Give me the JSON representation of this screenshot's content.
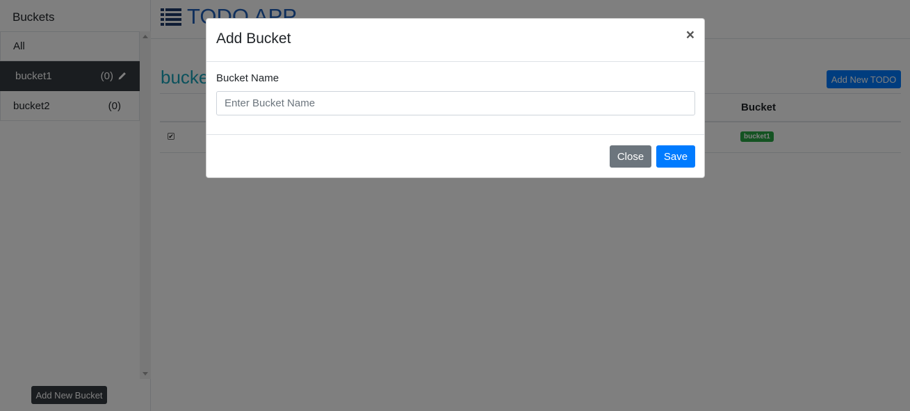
{
  "sidebar": {
    "title": "Buckets",
    "items": [
      {
        "name": "All",
        "count": ""
      },
      {
        "name": "bucket1",
        "count": "(0)"
      },
      {
        "name": "bucket2",
        "count": "(0)"
      }
    ],
    "add_button": "Add New Bucket"
  },
  "header": {
    "app_title": "TODO APP"
  },
  "main": {
    "section_title": "bucket1",
    "add_todo_button": "Add New TODO",
    "table": {
      "columns": [
        "",
        "Bucket"
      ],
      "rows": [
        {
          "checked": true,
          "bucket": "bucket1"
        }
      ]
    }
  },
  "modal": {
    "title": "Add Bucket",
    "close_symbol": "×",
    "field_label": "Bucket Name",
    "field_placeholder": "Enter Bucket Name",
    "field_value": "",
    "close_button": "Close",
    "save_button": "Save"
  },
  "colors": {
    "primary": "#007bff",
    "dark": "#343a40",
    "secondary": "#6c757d",
    "success": "#28a745",
    "info": "#17a2b8"
  },
  "icons": {
    "app_icon": "list-icon",
    "edit_icon": "pencil-icon"
  }
}
